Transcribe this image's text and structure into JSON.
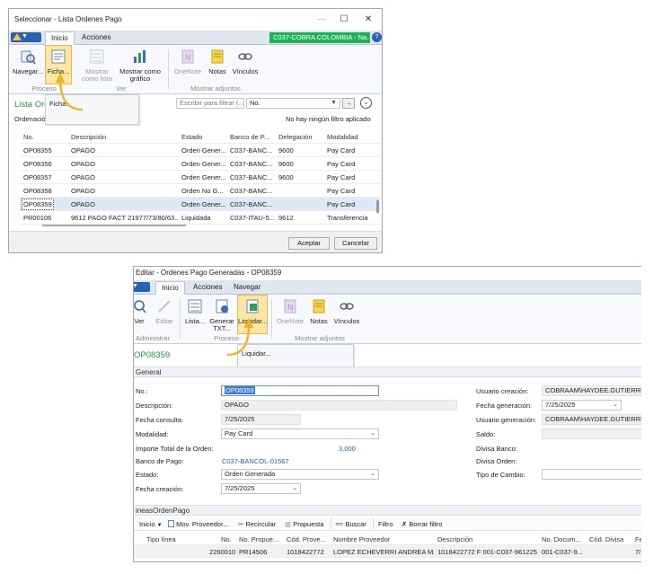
{
  "win1": {
    "title": "Seleccionar - Lista Ordenes Pago",
    "tabs": [
      "Inicio",
      "Acciones"
    ],
    "company": "C037-COBRA COLOMBIA - Na...",
    "ribbon": {
      "buttons": [
        "Navegar...",
        "Ficha...",
        "Mostrar como lista",
        "Mostrar como gráfico",
        "OneNote",
        "Notas",
        "Vínculos"
      ],
      "mostrar_lista": [
        "Mostrar",
        "como lista"
      ],
      "mostrar_grafico": [
        "Mostrar como",
        "gráfico"
      ],
      "groups": [
        "Proceso",
        "Ver",
        "Mostrar adjuntos"
      ]
    },
    "popup_label": "Ficha...",
    "page_title": "Lista Ord",
    "ordenacion_label": "Ordenació",
    "filter": {
      "placeholder": "Escribir para filtrar (...",
      "field": "No.",
      "status": "No hay ningún filtro aplicado"
    },
    "columns": [
      "No.",
      "Descripción",
      "Estado",
      "Banco de P...",
      "Delegación",
      "Modalidad"
    ],
    "rows": [
      [
        "OP08355",
        "OPAGO",
        "Orden Gener...",
        "C037-BANC...",
        "9600",
        "Pay Card"
      ],
      [
        "OP08356",
        "OPAGO",
        "Orden Gener...",
        "C037-BANC...",
        "9600",
        "Pay Card"
      ],
      [
        "OP08357",
        "OPAGO",
        "Orden Gener...",
        "C037-BANC...",
        "9600",
        "Pay Card"
      ],
      [
        "OP08358",
        "OPAGO",
        "Orden No G...",
        "C037-BANC...",
        "",
        "Pay Card"
      ],
      [
        "OP08359",
        "OPAGO",
        "Orden Gener...",
        "C037-BANC...",
        "",
        "Pay Card"
      ],
      [
        "PR00106",
        "9612 PAGO FACT 21977/73/80/63...",
        "Liquidada",
        "C037-ITAU-5...",
        "9612",
        "Transferencia"
      ]
    ],
    "buttons": {
      "accept": "Aceptar",
      "cancel": "Cancelar"
    }
  },
  "win2": {
    "title": "Editar - Ordenes Pago Generadas - OP08359",
    "tabs": [
      "Inicio",
      "Acciones",
      "Navegar"
    ],
    "ribbon": {
      "buttons": [
        "Ver",
        "Editar",
        "Lista...",
        "Generar TXT...",
        "Liquidar...",
        "OneNote",
        "Notas",
        "Vínculos"
      ],
      "generar": [
        "Generar",
        "TXT..."
      ],
      "groups": [
        "Administrar",
        "Proceso",
        "Mostrar adjuntos"
      ]
    },
    "popup_label": "Liquidar...",
    "page_title": "OP08359",
    "section_general": "General",
    "fields": {
      "no_label": "No.:",
      "no_value": "OP08359",
      "desc_label": "Descripción:",
      "desc_value": "OPAGO",
      "fecha_consulta_label": "Fecha consulta:",
      "fecha_consulta_value": "7/25/2025",
      "modalidad_label": "Modalidad:",
      "modalidad_value": "Pay Card",
      "importe_label": "Importe Total de la Orden:",
      "importe_value": "3,000",
      "banco_label": "Banco de Pago:",
      "banco_value": "C037-BANCOL-01567",
      "estado_label": "Estado:",
      "estado_value": "Orden Generada",
      "fecha_creacion_label": "Fecha creación:",
      "fecha_creacion_value": "7/25/2025",
      "usuario_creacion_label": "Usuario creación:",
      "usuario_creacion_value": "COBRAAM\\HAYDEE.GUTIERREZ",
      "fecha_generacion_label": "Fecha generación:",
      "fecha_generacion_value": "7/25/2025",
      "usuario_generacion_label": "Usuario generación:",
      "usuario_generacion_value": "COBRAAM\\HAYDEE.GUTIERREZ",
      "saldo_label": "Saldo:",
      "divisa_banco_label": "Divisa Banco:",
      "divisa_orden_label": "Divisa Orden:",
      "tipo_cambio_label": "Tipo de Cambio:"
    },
    "lines_section": "ineasOrdenPago",
    "lines_toolbar": [
      "Inicio",
      "Mov. Proveedor...",
      "Recircular",
      "Propuesta",
      "Buscar",
      "Filtro",
      "Borrar filtro"
    ],
    "lines_columns": [
      "Tipo línea",
      "No.",
      "No. Propue...",
      "Cód. Prove...",
      "Nombre Proveedor",
      "Descripción",
      "No. Docum...",
      "Cód. Divisa",
      "Fe"
    ],
    "lines_rows": [
      [
        "",
        "2260010",
        "PR14506",
        "1018422772",
        "LOPEZ ECHEVERRI ANDREA MA...",
        "1018422772  F 001-C037-961225...",
        "001-C037-9...",
        "",
        "7/"
      ]
    ]
  },
  "colors": {
    "accent_blue": "#2b61b4",
    "company_green": "#1fb25a",
    "highlight": "#fbe6a6",
    "arrow": "#f5b21a",
    "selected_row": "#dbe9f9"
  }
}
